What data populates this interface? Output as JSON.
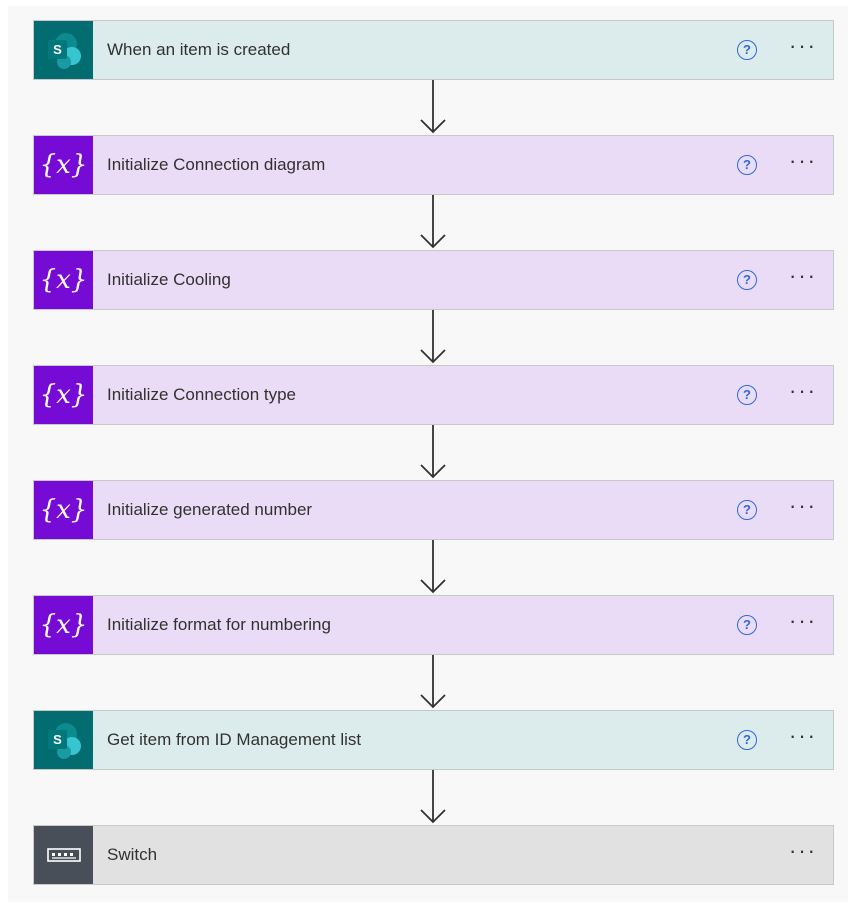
{
  "steps": [
    {
      "label": "When an item is created",
      "kind": "sharepoint",
      "icon": "sharepoint-icon",
      "has_help": true
    },
    {
      "label": "Initialize Connection diagram",
      "kind": "variable",
      "icon": "variable-icon",
      "has_help": true
    },
    {
      "label": "Initialize Cooling",
      "kind": "variable",
      "icon": "variable-icon",
      "has_help": true
    },
    {
      "label": "Initialize Connection type",
      "kind": "variable",
      "icon": "variable-icon",
      "has_help": true
    },
    {
      "label": "Initialize generated number",
      "kind": "variable",
      "icon": "variable-icon",
      "has_help": true
    },
    {
      "label": "Initialize format for numbering",
      "kind": "variable",
      "icon": "variable-icon",
      "has_help": true
    },
    {
      "label": "Get item from ID Management list",
      "kind": "sharepoint",
      "icon": "sharepoint-icon",
      "has_help": true
    },
    {
      "label": "Switch",
      "kind": "control",
      "icon": "switch-icon",
      "has_help": false
    }
  ],
  "icons": {
    "help_glyph": "?",
    "more_glyph": "···",
    "variable_glyph": "{𝑥}",
    "sharepoint_letter": "S"
  },
  "colors": {
    "sharepoint_bg": "#dcebec",
    "sharepoint_icon": "#036c70",
    "variable_bg": "#eadcf6",
    "variable_icon": "#770bd6",
    "control_bg": "#e1e1e1",
    "control_icon": "#484f58",
    "help_blue": "#2f6ad6"
  }
}
